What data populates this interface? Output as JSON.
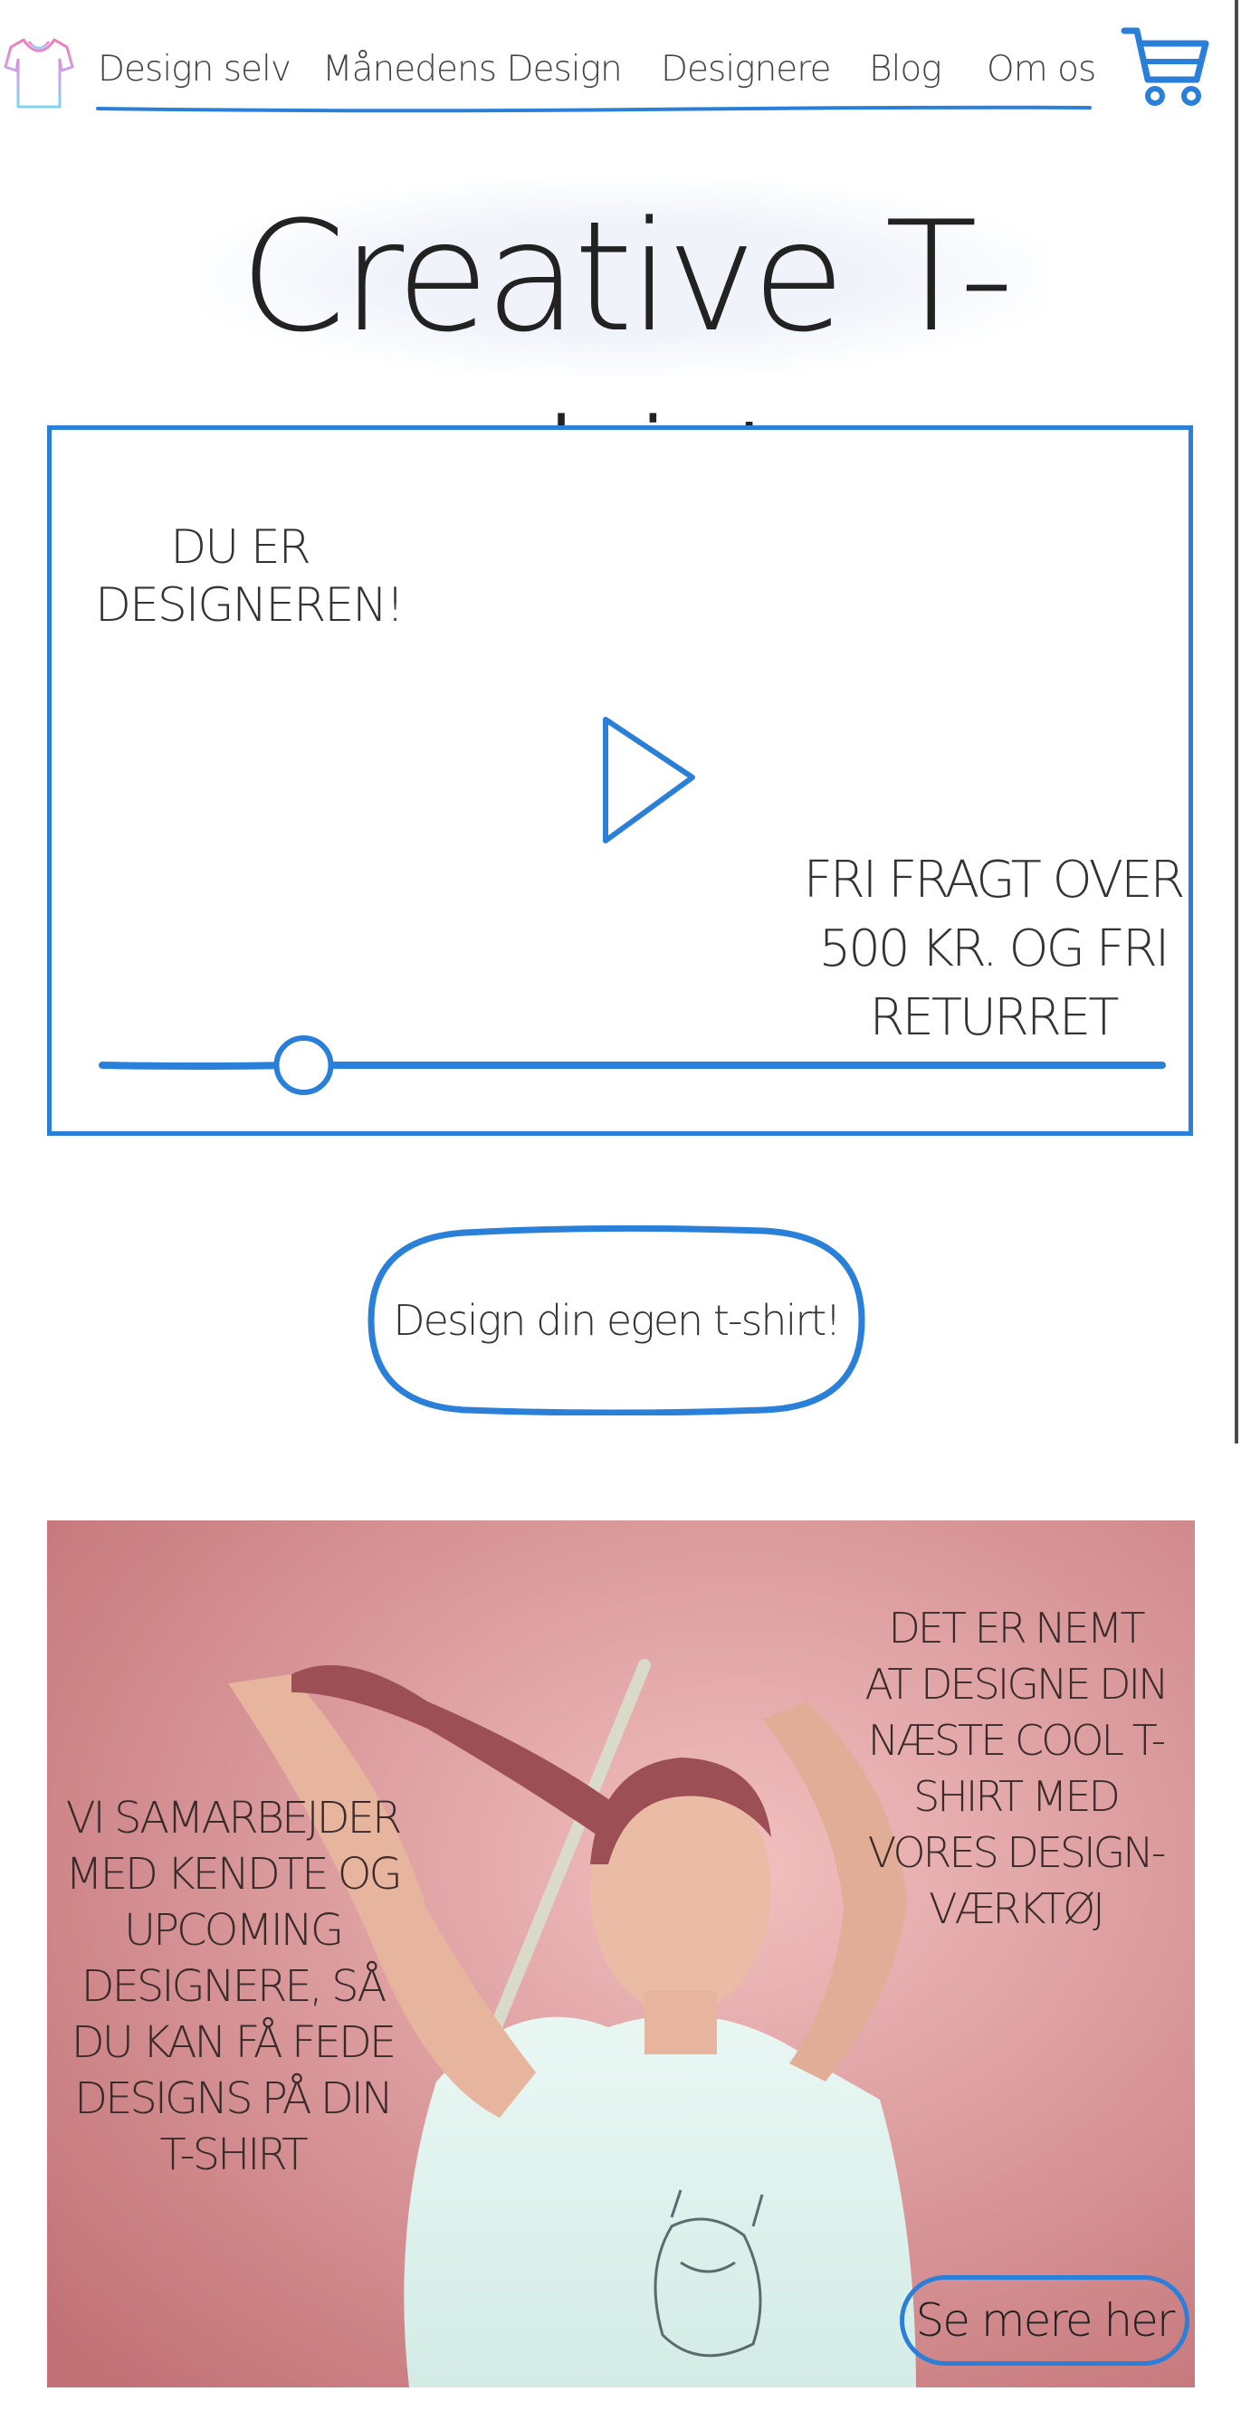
{
  "nav": {
    "items": [
      {
        "label": "Design selv"
      },
      {
        "label": "Månedens Design"
      },
      {
        "label": "Designere"
      },
      {
        "label": "Blog"
      },
      {
        "label": "Om os"
      }
    ],
    "logo_icon": "tshirt-icon",
    "cart_icon": "cart-icon"
  },
  "hero": {
    "title": "Creative T-shirt"
  },
  "video": {
    "text_top_left": "DU ER DESIGNEREN!",
    "text_bottom_right": "FRI FRAGT OVER 500 KR. OG FRI RETURRET",
    "play_icon": "play-icon",
    "progress": 0.19
  },
  "cta": {
    "label": "Design din egen t-shirt!"
  },
  "photo_section": {
    "left_text": "VI SAMARBEJDER MED KENDTE OG UPCOMING DESIGNERE, SÅ DU KAN FÅ FEDE DESIGNS PÅ DIN T-SHIRT",
    "right_text": "DET ER NEMT AT DESIGNE DIN NÆSTE COOL T-SHIRT MED VORES DESIGN-VÆRKTØJ",
    "button_label": "Se mere her"
  },
  "colors": {
    "accent": "#2a7fd8",
    "photo_bg": "#e7a6a8"
  }
}
